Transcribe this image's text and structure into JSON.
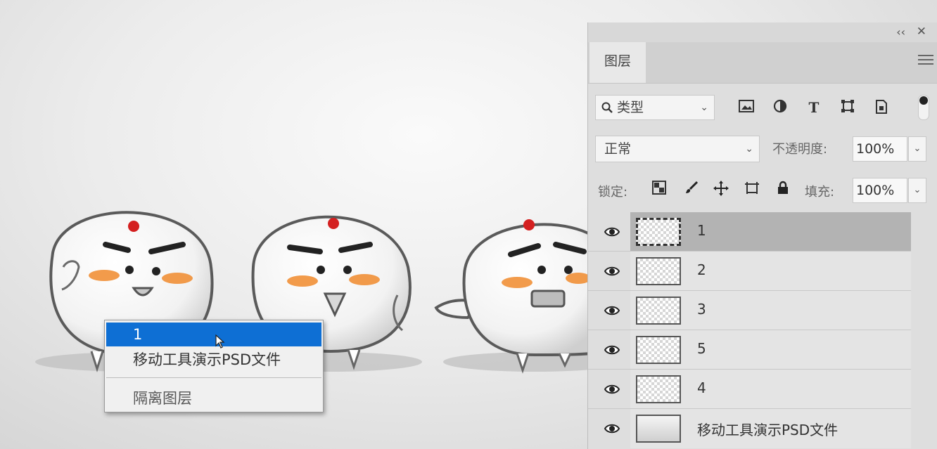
{
  "context_menu": {
    "items": [
      {
        "label": "1",
        "selected": true
      },
      {
        "label": "移动工具演示PSD文件",
        "selected": false
      },
      {
        "label": "隔离图层",
        "selected": false
      }
    ]
  },
  "layers_panel": {
    "tab_label": "图层",
    "filter": {
      "icon": "search-icon",
      "label": "类型"
    },
    "filter_icons": [
      "image-icon",
      "adjustment-icon",
      "type-icon",
      "shape-icon",
      "smart-object-icon"
    ],
    "blend_mode": "正常",
    "opacity_label": "不透明度:",
    "opacity_value": "100%",
    "lock_label": "锁定:",
    "lock_icons": [
      "lock-transparent-icon",
      "lock-paint-icon",
      "lock-move-icon",
      "lock-artboard-icon",
      "lock-all-icon"
    ],
    "fill_label": "填充:",
    "fill_value": "100%",
    "layers": [
      {
        "name": "1",
        "selected": true
      },
      {
        "name": "2",
        "selected": false
      },
      {
        "name": "3",
        "selected": false
      },
      {
        "name": "5",
        "selected": false
      },
      {
        "name": "4",
        "selected": false
      },
      {
        "name": "移动工具演示PSD文件",
        "selected": false,
        "background": true
      }
    ]
  },
  "colors": {
    "menu_highlight": "#0e6fd4",
    "selected_layer": "#b3b3b3",
    "cheek": "#f08a2c",
    "comb": "#d42020"
  }
}
